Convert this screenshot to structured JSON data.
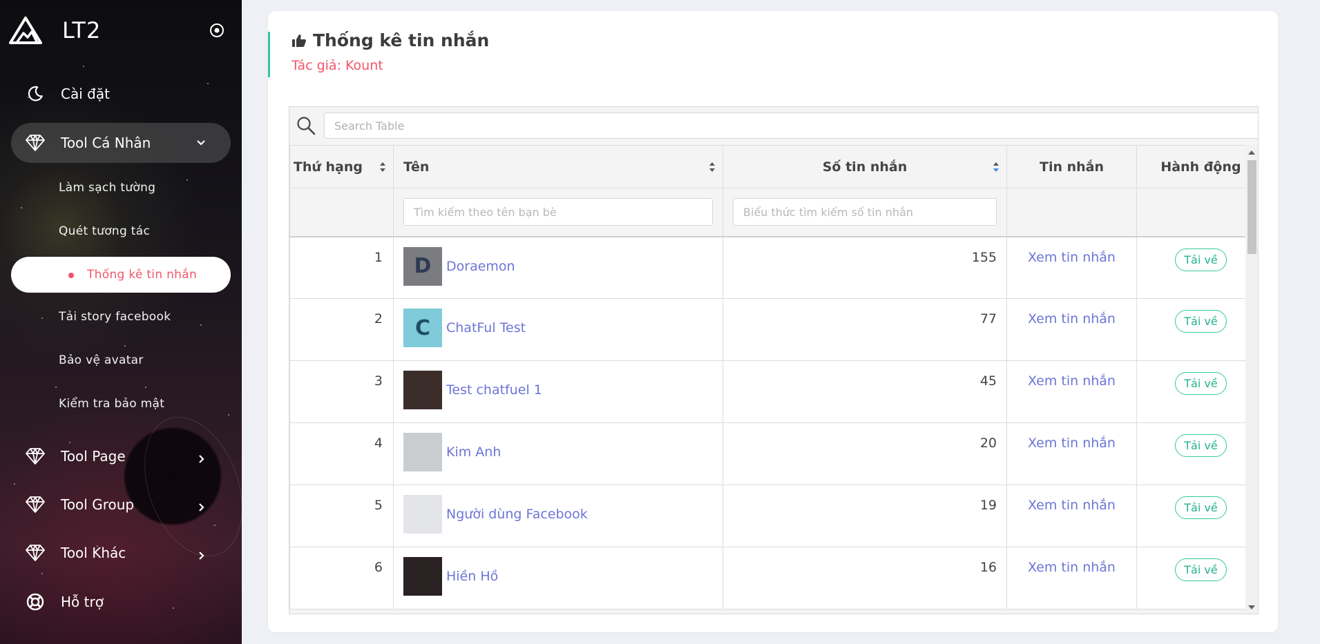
{
  "sidebar": {
    "brand": "LT2",
    "items": [
      {
        "label": "Cài đặt",
        "icon": "moon-icon"
      },
      {
        "label": "Tool Cá Nhân",
        "icon": "diamond-icon",
        "expanded": true
      },
      {
        "label": "Tool Page",
        "icon": "diamond-icon"
      },
      {
        "label": "Tool Group",
        "icon": "diamond-icon"
      },
      {
        "label": "Tool Khác",
        "icon": "diamond-icon"
      },
      {
        "label": "Hỗ trợ",
        "icon": "lifebuoy-icon"
      }
    ],
    "subitems": [
      "Làm sạch tường",
      "Quét tương tác",
      "Thống kê tin nhắn",
      "Tải story facebook",
      "Bảo vệ avatar",
      "Kiểm tra bảo mật"
    ],
    "active_subitem": "Thống kê tin nhắn"
  },
  "page": {
    "title": "Thống kê tin nhắn",
    "author": "Tác giả: Kount"
  },
  "table": {
    "search_placeholder": "Search Table",
    "columns": [
      "Thứ hạng",
      "Tên",
      "Số tin nhắn",
      "Tin nhắn",
      "Hành động"
    ],
    "filter_name_placeholder": "Tìm kiếm theo tên bạn bè",
    "filter_count_placeholder": "Biểu thức tìm kiếm số tin nhắn",
    "rows": [
      {
        "rank": "1",
        "name": "Doraemon",
        "count": "155",
        "avatar_letter": "D",
        "avatar_color": "#7a7c80",
        "avatar_text": "#2f3a55",
        "msg": "Xem tin nhắn",
        "action": "Tải về"
      },
      {
        "rank": "2",
        "name": "ChatFul Test",
        "count": "77",
        "avatar_letter": "C",
        "avatar_color": "#7fcbd9",
        "avatar_text": "#1e4f66",
        "msg": "Xem tin nhắn",
        "action": "Tải về"
      },
      {
        "rank": "3",
        "name": "Test chatfuel 1",
        "count": "45",
        "avatar_letter": "",
        "avatar_color": "#3b2e2a",
        "avatar_text": "#fff",
        "msg": "Xem tin nhắn",
        "action": "Tải về"
      },
      {
        "rank": "4",
        "name": "Kim Anh",
        "count": "20",
        "avatar_letter": "",
        "avatar_color": "#c9cdd0",
        "avatar_text": "#fff",
        "msg": "Xem tin nhắn",
        "action": "Tải về"
      },
      {
        "rank": "5",
        "name": "Người dùng Facebook",
        "count": "19",
        "avatar_letter": "",
        "avatar_color": "#e3e5e8",
        "avatar_text": "#fff",
        "msg": "Xem tin nhắn",
        "action": "Tải về"
      },
      {
        "rank": "6",
        "name": "Hiền Hồ",
        "count": "16",
        "avatar_letter": "",
        "avatar_color": "#2a2222",
        "avatar_text": "#fff",
        "msg": "Xem tin nhắn",
        "action": "Tải về"
      }
    ]
  },
  "colors": {
    "accent_green": "#33c9a0",
    "accent_pink": "#f0566b",
    "link_blue": "#6c75d6"
  }
}
